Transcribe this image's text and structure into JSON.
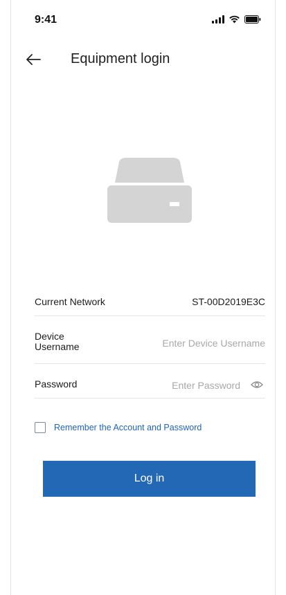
{
  "status_bar": {
    "time": "9:41",
    "icons": [
      "signal-icon",
      "wifi-icon",
      "battery-icon"
    ]
  },
  "header": {
    "back_icon": "arrow-left-icon",
    "title": "Equipment login"
  },
  "illustration": {
    "icon": "storage-device-icon"
  },
  "form": {
    "network": {
      "label": "Current Network",
      "value": "ST-00D2019E3C"
    },
    "username": {
      "label": "Device Username",
      "placeholder": "Enter Device Username",
      "value": ""
    },
    "password": {
      "label": "Password",
      "placeholder": "Enter Password",
      "value": "",
      "toggle_icon": "eye-icon"
    },
    "remember": {
      "label": "Remember the Account and Password",
      "checked": false
    }
  },
  "actions": {
    "login_label": "Log in"
  },
  "colors": {
    "accent": "#2368b5",
    "link": "#1f63b8",
    "device_gray": "#d4d4d4",
    "divider": "#e4e4e4"
  }
}
